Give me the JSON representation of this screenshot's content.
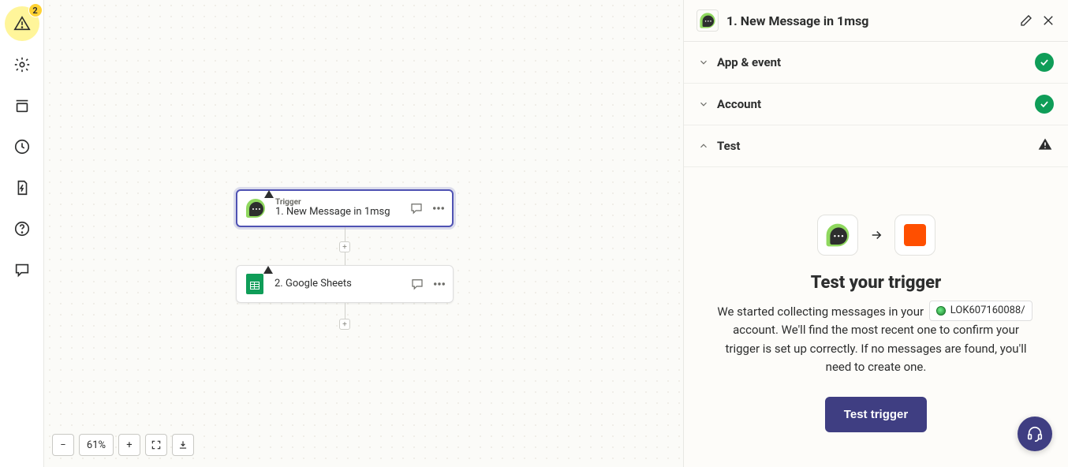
{
  "rail": {
    "alert_count": "2"
  },
  "canvas": {
    "node1": {
      "supertitle": "Trigger",
      "title": "1. New Message in 1msg"
    },
    "node2": {
      "title": "2. Google Sheets"
    },
    "zoom": {
      "value": "61%",
      "minus": "−",
      "plus": "+"
    }
  },
  "panel": {
    "title": "1. New Message in 1msg",
    "sections": {
      "app_event": "App & event",
      "account": "Account",
      "test": "Test"
    },
    "test": {
      "heading": "Test your trigger",
      "body_prefix": "We started collecting messages in your",
      "account_chip": "LOK607160088/",
      "body_suffix": "account. We'll find the most recent one to confirm your trigger is set up correctly. If no messages are found, you'll need to create one.",
      "button": "Test trigger"
    }
  }
}
